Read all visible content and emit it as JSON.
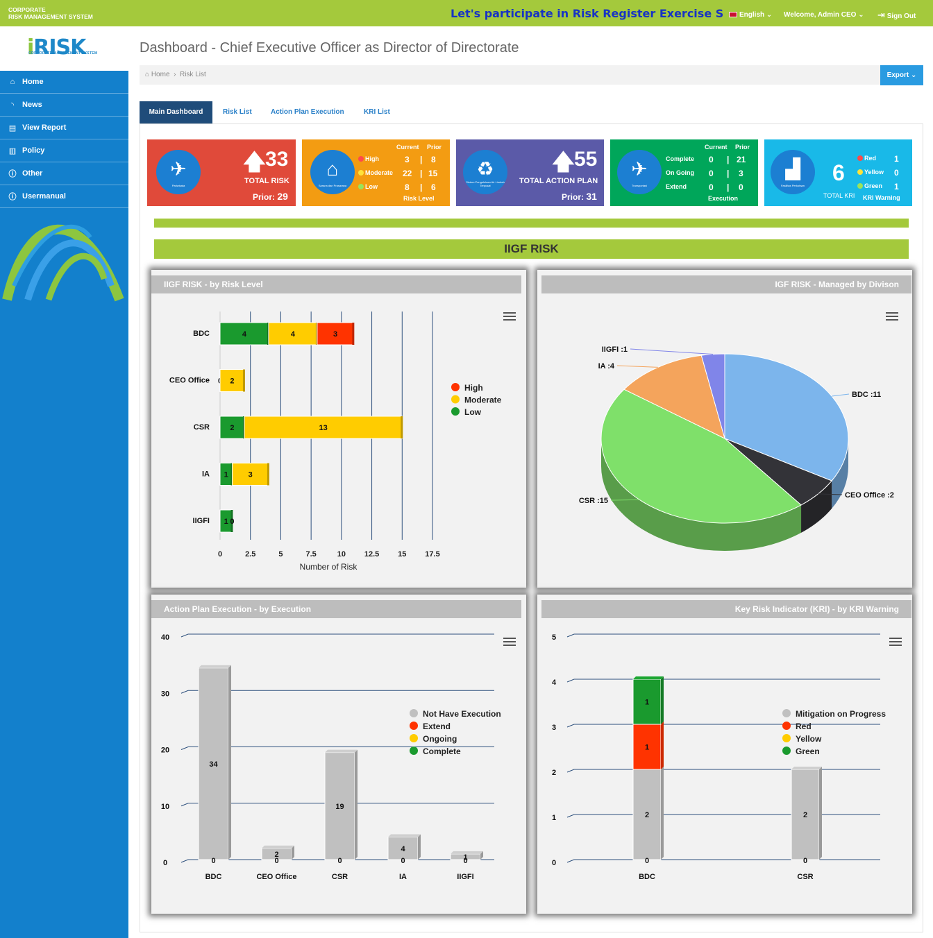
{
  "topbar": {
    "brand_line1": "CORPORATE",
    "brand_line2": "RISK MANAGEMENT SYSTEM",
    "marquee": "Let's participate in Risk Register Exercise Semester",
    "language": "English",
    "welcome": "Welcome, Admin CEO",
    "signout": "Sign Out"
  },
  "logo": {
    "main_i": "i",
    "main_risk": "RISK",
    "sub": "CORPORATE MANAGEMENT SYSTEM"
  },
  "sidebar": {
    "items": [
      {
        "label": "Home",
        "icon": "bank-icon"
      },
      {
        "label": "News",
        "icon": "rss-icon"
      },
      {
        "label": "View Report",
        "icon": "file-icon"
      },
      {
        "label": "Policy",
        "icon": "book-icon"
      },
      {
        "label": "Other",
        "icon": "info-icon"
      },
      {
        "label": "Usermanual",
        "icon": "info-icon"
      }
    ]
  },
  "page": {
    "title": "Dashboard - Chief Executive Officer as Director of Directorate",
    "breadcrumb_home": "Home",
    "breadcrumb_current": "Risk List",
    "export": "Export"
  },
  "tabs": [
    "Main Dashboard",
    "Risk List",
    "Action Plan Execution",
    "KRI List"
  ],
  "cards": {
    "total_risk": {
      "value": "33",
      "label": "TOTAL RISK",
      "prior_label": "Prior:",
      "prior": "29",
      "icon_caption": "Pariwisata",
      "color": "#e04a3a"
    },
    "risk_level": {
      "current": "Current",
      "prior": "Prior",
      "rows": [
        {
          "label": "High",
          "cur": "3",
          "pri": "8"
        },
        {
          "label": "Moderate",
          "cur": "22",
          "pri": "15"
        },
        {
          "label": "Low",
          "cur": "8",
          "pri": "6"
        }
      ],
      "footer": "Risk Level",
      "icon_caption": "Sarana dan Prasarana",
      "color": "#f39c12"
    },
    "total_action": {
      "value": "55",
      "label": "TOTAL ACTION PLAN",
      "prior_label": "Prior:",
      "prior": "31",
      "icon_caption": "Sistem Pengelolaan Air Limbah Terpusat",
      "color": "#5b5aa8"
    },
    "execution": {
      "current": "Current",
      "prior": "Prior",
      "rows": [
        {
          "label": "Complete",
          "cur": "0",
          "pri": "21"
        },
        {
          "label": "On Going",
          "cur": "0",
          "pri": "3"
        },
        {
          "label": "Extend",
          "cur": "0",
          "pri": "0"
        }
      ],
      "footer": "Execution",
      "icon_caption": "Transportasi",
      "color": "#00a65a"
    },
    "kri": {
      "value": "6",
      "label": "TOTAL KRI",
      "rows": [
        {
          "label": "Red",
          "val": "1"
        },
        {
          "label": "Yellow",
          "val": "0"
        },
        {
          "label": "Green",
          "val": "1"
        }
      ],
      "footer": "KRI Warning",
      "icon_caption": "Fasilitas Perkotaan",
      "color": "#19b9e8"
    }
  },
  "section_title": "IIGF RISK",
  "panels": {
    "p1": "IIGF RISK - by Risk Level",
    "p2": "IGF RISK - Managed by Divison",
    "p3": "Action Plan Execution - by Execution",
    "p4": "Key Risk Indicator (KRI) - by KRI Warning"
  },
  "chart_data": [
    {
      "type": "bar",
      "title": "IIGF RISK - by Risk Level",
      "orientation": "horizontal",
      "stacked": true,
      "categories": [
        "BDC",
        "CEO Office",
        "CSR",
        "IA",
        "IIGFI"
      ],
      "series": [
        {
          "name": "Low",
          "color": "#1a9a2e",
          "values": [
            4,
            0,
            2,
            1,
            1
          ]
        },
        {
          "name": "Moderate",
          "color": "#ffcc00",
          "values": [
            4,
            2,
            13,
            3,
            0
          ]
        },
        {
          "name": "High",
          "color": "#ff3300",
          "values": [
            3,
            0,
            0,
            0,
            0
          ]
        }
      ],
      "xlabel": "Number of Risk",
      "xlim": [
        0,
        17.5
      ],
      "xticks": [
        "0",
        "2.5",
        "5",
        "7.5",
        "10",
        "12.5",
        "15",
        "17.5"
      ],
      "legend": "right"
    },
    {
      "type": "pie",
      "title": "IGF RISK - Managed by Divison",
      "labels": [
        "BDC",
        "CEO Office",
        "CSR",
        "IA",
        "IIGFI"
      ],
      "values": [
        11,
        2,
        15,
        4,
        1
      ],
      "colors": [
        "#7cb5ec",
        "#333338",
        "#7fe06a",
        "#f4a45c",
        "#8085e9"
      ],
      "label_texts": [
        "BDC :11",
        "CEO Office :2",
        "CSR :15",
        "IA :4",
        "IIGFI :1"
      ]
    },
    {
      "type": "bar",
      "title": "Action Plan Execution - by Execution",
      "stacked": true,
      "categories": [
        "BDC",
        "CEO Office",
        "CSR",
        "IA",
        "IIGFI"
      ],
      "series": [
        {
          "name": "Not Have Execution",
          "color": "#c0c0c0",
          "values": [
            34,
            2,
            19,
            4,
            1
          ]
        },
        {
          "name": "Extend",
          "color": "#ff3300",
          "values": [
            0,
            0,
            0,
            0,
            0
          ]
        },
        {
          "name": "Ongoing",
          "color": "#ffcc00",
          "values": [
            0,
            0,
            0,
            0,
            0
          ]
        },
        {
          "name": "Complete",
          "color": "#1a9a2e",
          "values": [
            0,
            0,
            0,
            0,
            0
          ]
        }
      ],
      "ylim": [
        0,
        40
      ],
      "yticks": [
        "0",
        "10",
        "20",
        "30",
        "40"
      ],
      "legend": "right"
    },
    {
      "type": "bar",
      "title": "Key Risk Indicator (KRI) - by KRI Warning",
      "stacked": true,
      "categories": [
        "BDC",
        "CSR"
      ],
      "series": [
        {
          "name": "Mitigation on Progress",
          "color": "#c0c0c0",
          "values": [
            2,
            2
          ]
        },
        {
          "name": "Red",
          "color": "#ff3300",
          "values": [
            1,
            0
          ]
        },
        {
          "name": "Yellow",
          "color": "#ffcc00",
          "values": [
            0,
            0
          ]
        },
        {
          "name": "Green",
          "color": "#1a9a2e",
          "values": [
            1,
            0
          ]
        }
      ],
      "ylim": [
        0,
        5
      ],
      "yticks": [
        "0",
        "1",
        "2",
        "3",
        "4",
        "5"
      ],
      "legend": "right"
    }
  ]
}
